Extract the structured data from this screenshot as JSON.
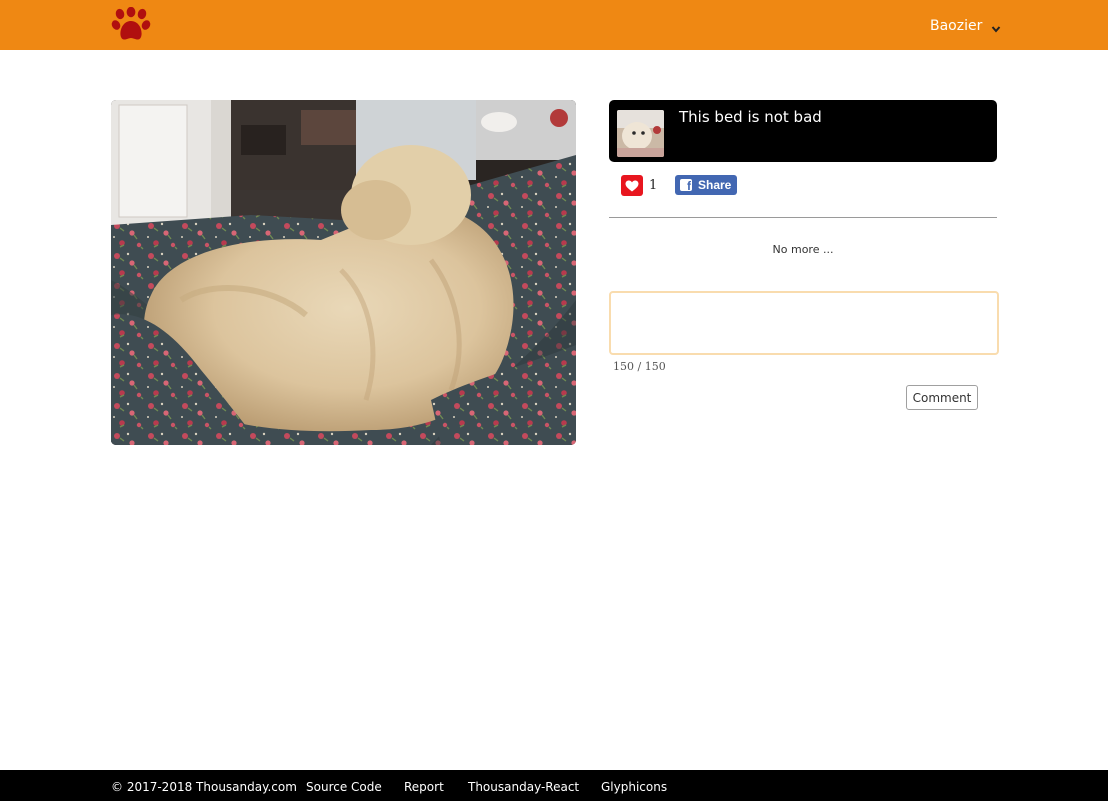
{
  "header": {
    "logo_icon": "paw-icon",
    "brand_color": "#ef8813",
    "logo_color": "#b00f0f",
    "user_name": "Baozier",
    "menu_icon": "chevron-down-icon"
  },
  "post": {
    "title": "This bed is not bad",
    "likes": "1",
    "like_icon": "heart-icon",
    "share_label": "Share",
    "share_icon": "facebook-icon"
  },
  "comments": {
    "empty_text": "No more ...",
    "input_value": "",
    "char_count": "150 / 150",
    "submit_label": "Comment"
  },
  "footer": {
    "copyright": "© 2017-2018 Thousanday.com",
    "links": [
      "Source Code",
      "Report",
      "Thousanday-React",
      "Glyphicons"
    ]
  }
}
